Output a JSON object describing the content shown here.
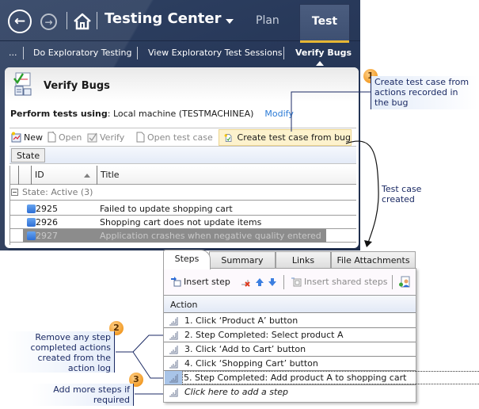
{
  "app": {
    "title": "Testing Center",
    "tabs": [
      {
        "label": "Plan",
        "active": false
      },
      {
        "label": "Test",
        "active": true
      }
    ],
    "subnav": {
      "overflow": "...",
      "items": [
        {
          "label": "Do Exploratory Testing",
          "active": false
        },
        {
          "label": "View Exploratory Test Sessions",
          "active": false
        },
        {
          "label": "Verify Bugs",
          "active": true
        }
      ]
    },
    "accent_color": "#e5b634"
  },
  "verify_bugs": {
    "title": "Verify Bugs",
    "perform_label": "Perform tests using",
    "perform_value": ": Local machine (TESTMACHINEA)",
    "modify_link": "Modify",
    "toolbar": {
      "new": "New",
      "open": "Open",
      "verify": "Verify",
      "open_test_case": "Open test case",
      "create_from_bug": "Create test case from bug"
    },
    "group_by_chip": "State",
    "columns": {
      "id": "ID",
      "title": "Title"
    },
    "group": "State: Active (3)",
    "bugs": [
      {
        "id": "2925",
        "title": "Failed to update shopping cart",
        "selected": false
      },
      {
        "id": "2926",
        "title": "Shopping cart does not update items",
        "selected": false
      },
      {
        "id": "2927",
        "title": "Application crashes when negative quality entered",
        "selected": true
      }
    ]
  },
  "test_case": {
    "tabs": [
      "Steps",
      "Summary",
      "Links",
      "File Attachments"
    ],
    "active_tab": "Steps",
    "toolbar": {
      "insert_step": "Insert step",
      "insert_shared_steps": "Insert shared steps"
    },
    "column": "Action",
    "steps": [
      "1. Click ‘Product A’ button",
      "2. Step Completed: Select product A",
      "3. Click ‘Add to Cart’ button",
      "4. Click ‘Shopping Cart’ button",
      "5. Step Completed: Add product A to shopping cart"
    ],
    "add_step_placeholder": "Click here to add a step"
  },
  "callouts": {
    "one": {
      "number": "1",
      "text": "Create test case from actions recorded in the bug"
    },
    "created": {
      "text": "Test case created"
    },
    "two": {
      "number": "2",
      "text": "Remove any step completed actions created from the action log"
    },
    "three": {
      "number": "3",
      "text": "Add more steps if required"
    }
  }
}
